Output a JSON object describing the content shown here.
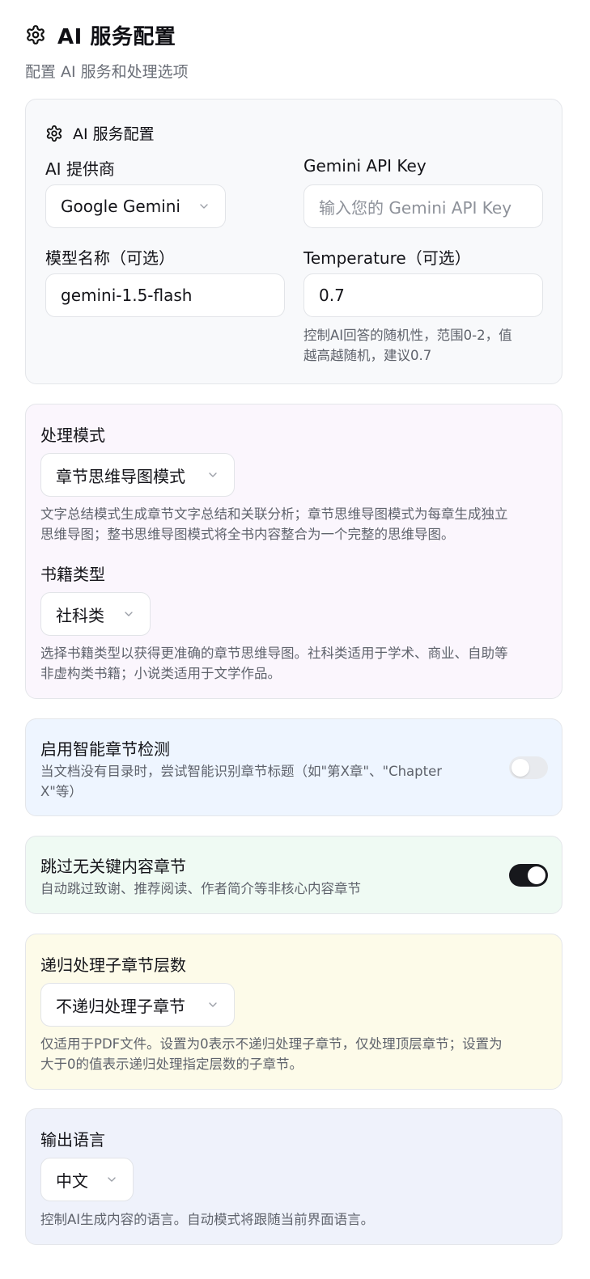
{
  "header": {
    "title": "AI 服务配置",
    "subtitle": "配置 AI 服务和处理选项",
    "icon": "gear-icon"
  },
  "ai_service": {
    "section_title": "AI 服务配置",
    "provider_label": "AI 提供商",
    "provider_value": "Google Gemini",
    "api_key_label": "Gemini API Key",
    "api_key_placeholder": "输入您的 Gemini API Key",
    "model_label": "模型名称（可选）",
    "model_value": "gemini-1.5-flash",
    "temperature_label": "Temperature（可选）",
    "temperature_value": "0.7",
    "temperature_help_line1": "控制AI回答的随机性，范围0-2，值",
    "temperature_help_line2": "越高越随机，建议0.7"
  },
  "processing": {
    "mode_label": "处理模式",
    "mode_value": "章节思维导图模式",
    "mode_help_line1": "文字总结模式生成章节文字总结和关联分析；章节思维导图模式为每章生成独立",
    "mode_help_line2": "思维导图；整书思维导图模式将全书内容整合为一个完整的思维导图。",
    "book_type_label": "书籍类型",
    "book_type_value": "社科类",
    "book_type_help_line1": "选择书籍类型以获得更准确的章节思维导图。社科类适用于学术、商业、自助等",
    "book_type_help_line2": "非虚构类书籍；小说类适用于文学作品。"
  },
  "smart_detect": {
    "title": "启用智能章节检测",
    "desc_line1": "当文档没有目录时，尝试智能识别章节标题（如\"第X章\"、\"Chapter",
    "desc_line2": "X\"等）",
    "enabled": false
  },
  "skip_irrelevant": {
    "title": "跳过无关键内容章节",
    "desc": "自动跳过致谢、推荐阅读、作者简介等非核心内容章节",
    "enabled": true
  },
  "recursive": {
    "label": "递归处理子章节层数",
    "value": "不递归处理子章节",
    "help_line1": "仅适用于PDF文件。设置为0表示不递归处理子章节，仅处理顶层章节；设置为",
    "help_line2": "大于0的值表示递归处理指定层数的子章节。"
  },
  "language": {
    "label": "输出语言",
    "value": "中文",
    "help": "控制AI生成内容的语言。自动模式将跟随当前界面语言。"
  },
  "colors": {
    "toggle_on": "#17181c",
    "toggle_off": "#e8eaee",
    "card_mode_bg": "#fbf6fd",
    "card_detect_bg": "#eef5ff",
    "card_skip_bg": "#effaf3",
    "card_recursive_bg": "#fdfbe9",
    "card_lang_bg": "#eff2fb"
  }
}
